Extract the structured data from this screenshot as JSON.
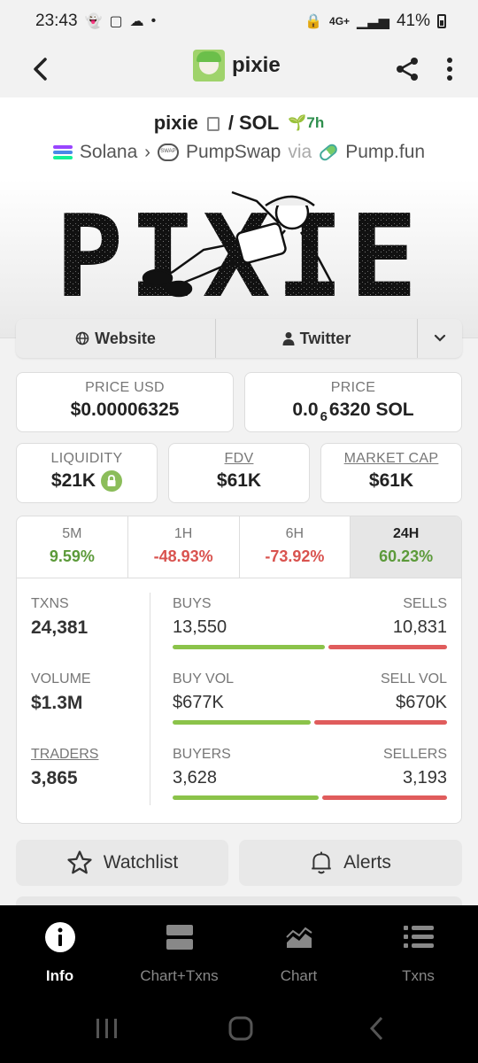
{
  "status_bar": {
    "time": "23:43",
    "signal_label": "4G+",
    "battery": "41%"
  },
  "header": {
    "title": "pixie"
  },
  "pair": {
    "base": "pixie",
    "separator": "/",
    "quote": "SOL",
    "age": "7h",
    "chain": "Solana",
    "dex": "PumpSwap",
    "via_label": "via",
    "launchpad": "Pump.fun"
  },
  "banner": {
    "text": "PIXIE"
  },
  "links": {
    "website": "Website",
    "twitter": "Twitter"
  },
  "price": {
    "usd_label": "PRICE USD",
    "usd_value": "$0.00006325",
    "native_label": "PRICE",
    "native_prefix": "0.0",
    "native_sub": "6",
    "native_rest": "6320 SOL"
  },
  "metrics": {
    "liquidity_label": "LIQUIDITY",
    "liquidity_value": "$21K",
    "fdv_label": "FDV",
    "fdv_value": "$61K",
    "mcap_label": "MARKET CAP",
    "mcap_value": "$61K"
  },
  "timeframes": [
    {
      "label": "5M",
      "change": "9.59%",
      "direction": "up"
    },
    {
      "label": "1H",
      "change": "-48.93%",
      "direction": "down"
    },
    {
      "label": "6H",
      "change": "-73.92%",
      "direction": "down"
    },
    {
      "label": "24H",
      "change": "60.23%",
      "direction": "up",
      "active": true
    }
  ],
  "stats": {
    "txns_label": "TXNS",
    "txns_value": "24,381",
    "buys_label": "BUYS",
    "buys_value": "13,550",
    "sells_label": "SELLS",
    "sells_value": "10,831",
    "buy_share": 0.556,
    "volume_label": "VOLUME",
    "volume_value": "$1.3M",
    "buy_vol_label": "BUY VOL",
    "buy_vol_value": "$677K",
    "sell_vol_label": "SELL VOL",
    "sell_vol_value": "$670K",
    "buy_vol_share": 0.503,
    "traders_label": "TRADERS",
    "traders_value": "3,865",
    "buyers_label": "BUYERS",
    "buyers_value": "3,628",
    "sellers_label": "SELLERS",
    "sellers_value": "3,193",
    "buyers_share": 0.532
  },
  "actions": {
    "watchlist": "Watchlist",
    "alerts": "Alerts"
  },
  "nav": [
    {
      "label": "Info",
      "icon": "info-icon",
      "active": true
    },
    {
      "label": "Chart+Txns",
      "icon": "split-layout-icon"
    },
    {
      "label": "Chart",
      "icon": "area-chart-icon"
    },
    {
      "label": "Txns",
      "icon": "list-icon"
    }
  ],
  "colors": {
    "positive": "#5c9a3a",
    "negative": "#d9534f",
    "buy_bar": "#8bc34a",
    "sell_bar": "#e05c5c"
  }
}
